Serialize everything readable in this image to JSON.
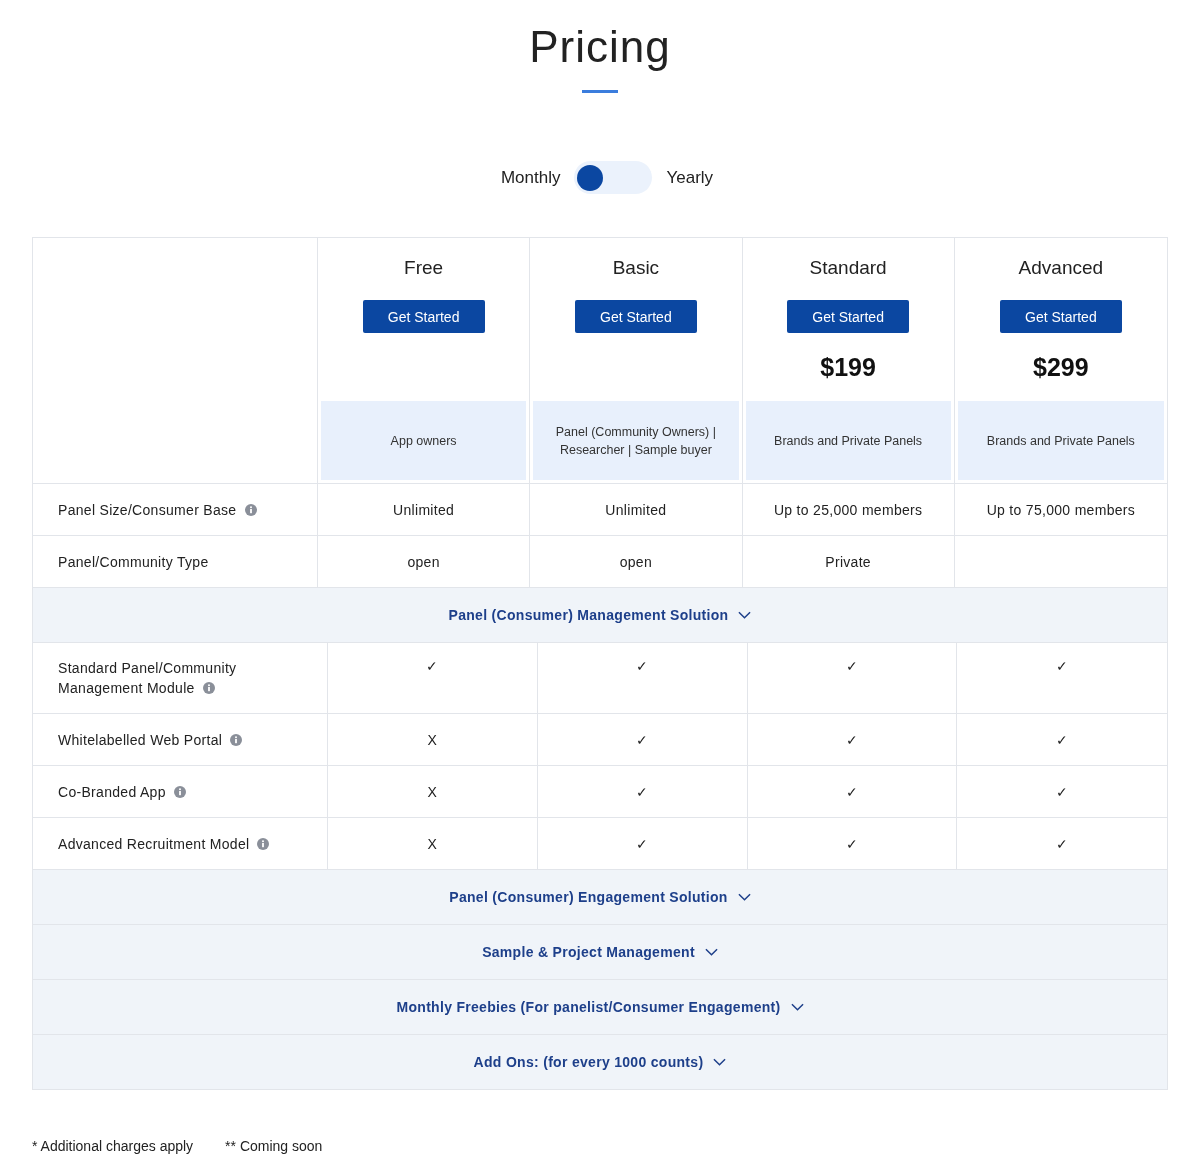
{
  "title": "Pricing",
  "billing_toggle": {
    "left_label": "Monthly",
    "right_label": "Yearly",
    "on": false
  },
  "plans": [
    {
      "name": "Free",
      "button": "Get Started",
      "audience": "App owners"
    },
    {
      "name": "Basic",
      "button": "Get Started",
      "audience": "Panel (Community Owners) | Researcher | Sample buyer"
    },
    {
      "name": "Standard",
      "button": "Get Started",
      "price": "$199",
      "audience": "Brands and Private Panels"
    },
    {
      "name": "Advanced",
      "button": "Get Started",
      "price": "$299",
      "audience": "Brands and Private Panels"
    }
  ],
  "top_rows": [
    {
      "label": "Panel Size/Consumer Base",
      "info": true,
      "values": [
        "Unlimited",
        "Unlimited",
        "Up to 25,000 members",
        "Up to 75,000 members"
      ]
    },
    {
      "label": "Panel/Community Type",
      "info": false,
      "values": [
        "open",
        "open",
        "Private"
      ]
    }
  ],
  "sections": [
    {
      "title": "Panel (Consumer) Management Solution",
      "rows": [
        {
          "label": "Standard Panel/Community Management Module",
          "info": true,
          "values": [
            "✓",
            "✓",
            "✓",
            "✓"
          ]
        },
        {
          "label": "Whitelabelled Web Portal",
          "info": true,
          "values": [
            "X",
            "✓",
            "✓",
            "✓"
          ]
        },
        {
          "label": "Co-Branded App",
          "info": true,
          "values": [
            "X",
            "✓",
            "✓",
            "✓"
          ]
        },
        {
          "label": "Advanced Recruitment Model",
          "info": true,
          "values": [
            "X",
            "✓",
            "✓",
            "✓"
          ]
        }
      ]
    },
    {
      "title": "Panel (Consumer) Engagement Solution"
    },
    {
      "title": "Sample & Project Management"
    },
    {
      "title": "Monthly Freebies (For panelist/Consumer Engagement)"
    },
    {
      "title": "Add Ons: (for every 1000 counts)"
    }
  ],
  "footnotes": [
    "* Additional charges apply",
    "** Coming soon"
  ]
}
